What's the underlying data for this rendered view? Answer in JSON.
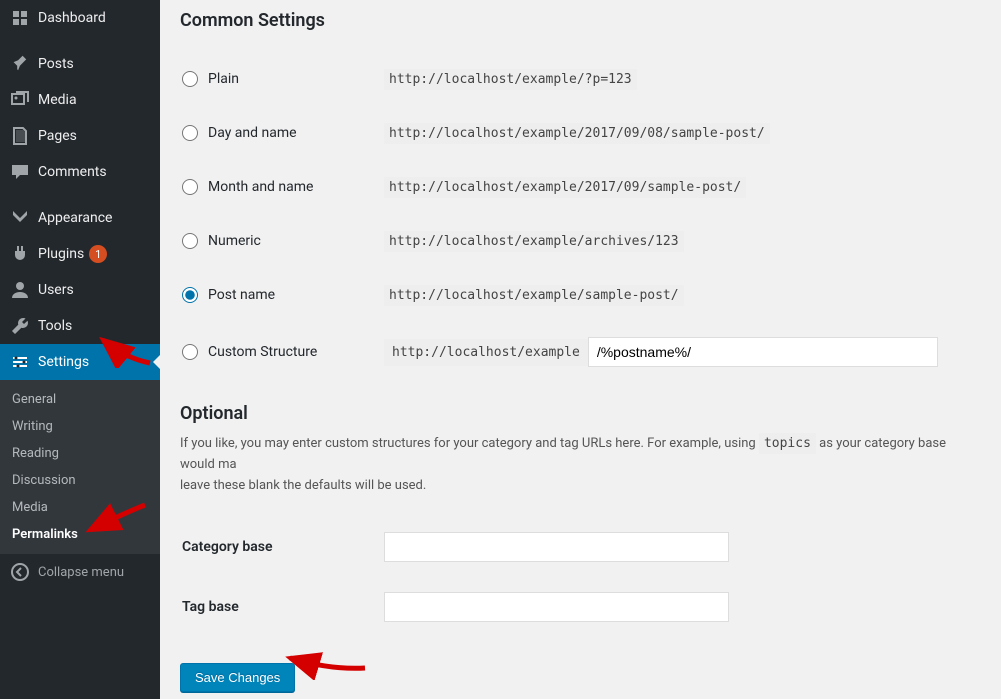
{
  "sidebar": {
    "items": [
      {
        "label": "Dashboard",
        "icon": "dashboard"
      },
      {
        "label": "Posts",
        "icon": "pin"
      },
      {
        "label": "Media",
        "icon": "media"
      },
      {
        "label": "Pages",
        "icon": "pages"
      },
      {
        "label": "Comments",
        "icon": "comments"
      },
      {
        "label": "Appearance",
        "icon": "appearance"
      },
      {
        "label": "Plugins",
        "icon": "plugins",
        "badge": "1"
      },
      {
        "label": "Users",
        "icon": "users"
      },
      {
        "label": "Tools",
        "icon": "tools"
      },
      {
        "label": "Settings",
        "icon": "settings",
        "active": true
      }
    ],
    "submenu": [
      {
        "label": "General"
      },
      {
        "label": "Writing"
      },
      {
        "label": "Reading"
      },
      {
        "label": "Discussion"
      },
      {
        "label": "Media"
      },
      {
        "label": "Permalinks",
        "current": true
      }
    ],
    "collapse_label": "Collapse menu"
  },
  "headings": {
    "common": "Common Settings",
    "optional": "Optional"
  },
  "permalinks": {
    "options": [
      {
        "label": "Plain",
        "example": "http://localhost/example/?p=123"
      },
      {
        "label": "Day and name",
        "example": "http://localhost/example/2017/09/08/sample-post/"
      },
      {
        "label": "Month and name",
        "example": "http://localhost/example/2017/09/sample-post/"
      },
      {
        "label": "Numeric",
        "example": "http://localhost/example/archives/123"
      },
      {
        "label": "Post name",
        "example": "http://localhost/example/sample-post/",
        "checked": true
      }
    ],
    "custom": {
      "label": "Custom Structure",
      "prefix": "http://localhost/example",
      "value": "/%postname%/"
    }
  },
  "optional": {
    "desc_pre": "If you like, you may enter custom structures for your category and tag URLs here. For example, using ",
    "desc_code": "topics",
    "desc_post": " as your category base would ma",
    "desc_line2": "leave these blank the defaults will be used.",
    "category_label": "Category base",
    "tag_label": "Tag base"
  },
  "buttons": {
    "save": "Save Changes"
  }
}
